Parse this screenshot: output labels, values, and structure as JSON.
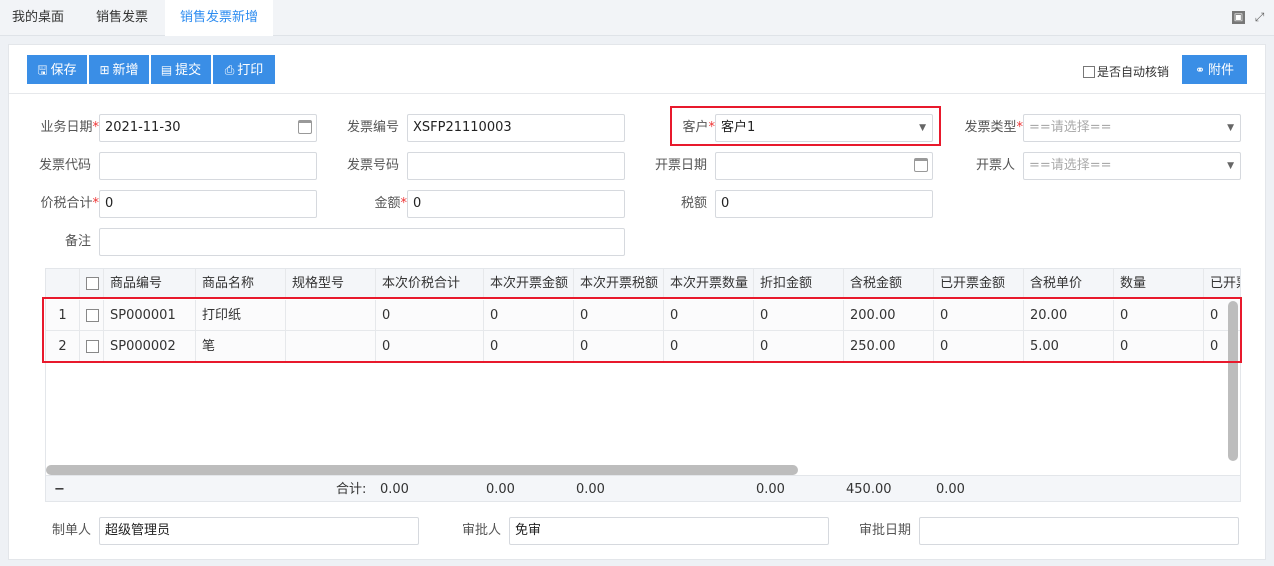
{
  "tabs": [
    {
      "label": "我的桌面"
    },
    {
      "label": "销售发票"
    },
    {
      "label": "销售发票新增"
    }
  ],
  "toolbar": {
    "save_label": "保存",
    "new_label": "新增",
    "submit_label": "提交",
    "print_label": "打印",
    "auto_writeoff_label": "是否自动核销",
    "attachment_label": "附件"
  },
  "form": {
    "business_date": {
      "label": "业务日期",
      "value": "2021-11-30"
    },
    "invoice_no": {
      "label": "发票编号",
      "value": "XSFP21110003"
    },
    "customer": {
      "label": "客户",
      "value": "客户1"
    },
    "invoice_type": {
      "label": "发票类型",
      "placeholder": "==请选择=="
    },
    "invoice_code": {
      "label": "发票代码",
      "value": ""
    },
    "invoice_number": {
      "label": "发票号码",
      "value": ""
    },
    "issue_date": {
      "label": "开票日期",
      "value": ""
    },
    "issuer": {
      "label": "开票人",
      "placeholder": "==请选择=="
    },
    "total_with_tax": {
      "label": "价税合计",
      "value": "0"
    },
    "amount": {
      "label": "金额",
      "value": "0"
    },
    "tax": {
      "label": "税额",
      "value": "0"
    },
    "remark": {
      "label": "备注",
      "value": ""
    }
  },
  "grid": {
    "columns": [
      "商品编号",
      "商品名称",
      "规格型号",
      "本次价税合计",
      "本次开票金额",
      "本次开票税额",
      "本次开票数量",
      "折扣金额",
      "含税金额",
      "已开票金额",
      "含税单价",
      "数量",
      "已开票"
    ],
    "rows": [
      {
        "idx": "1",
        "code": "SP000001",
        "name": "打印纸",
        "spec": "",
        "c1": "0",
        "c2": "0",
        "c3": "0",
        "c4": "0",
        "c5": "0",
        "c6": "200.00",
        "c7": "0",
        "c8": "20.00",
        "c9": "0",
        "c10": "0"
      },
      {
        "idx": "2",
        "code": "SP000002",
        "name": "笔",
        "spec": "",
        "c1": "0",
        "c2": "0",
        "c3": "0",
        "c4": "0",
        "c5": "0",
        "c6": "250.00",
        "c7": "0",
        "c8": "5.00",
        "c9": "0",
        "c10": "0"
      }
    ],
    "footer": {
      "collapse": "−",
      "label": "合计:",
      "t1": "0.00",
      "t2": "0.00",
      "t3": "0.00",
      "t5": "0.00",
      "t6": "450.00",
      "t7": "0.00"
    }
  },
  "bottom": {
    "creator": {
      "label": "制单人",
      "value": "超级管理员"
    },
    "approver": {
      "label": "审批人",
      "value": "免审"
    },
    "approve_date": {
      "label": "审批日期",
      "value": ""
    }
  },
  "icons": {
    "save": "save-icon",
    "new": "plus-square-icon",
    "submit": "document-icon",
    "print": "printer-icon",
    "attachment": "link-icon",
    "restore": "window-restore-icon",
    "maximize": "expand-icon",
    "calendar": "calendar-icon",
    "dropdown": "chevron-down-icon"
  },
  "colors": {
    "accent": "#3a8ee6",
    "active_tab": "#2d8cf0",
    "highlight": "#e8192c",
    "required": "#e33333"
  }
}
